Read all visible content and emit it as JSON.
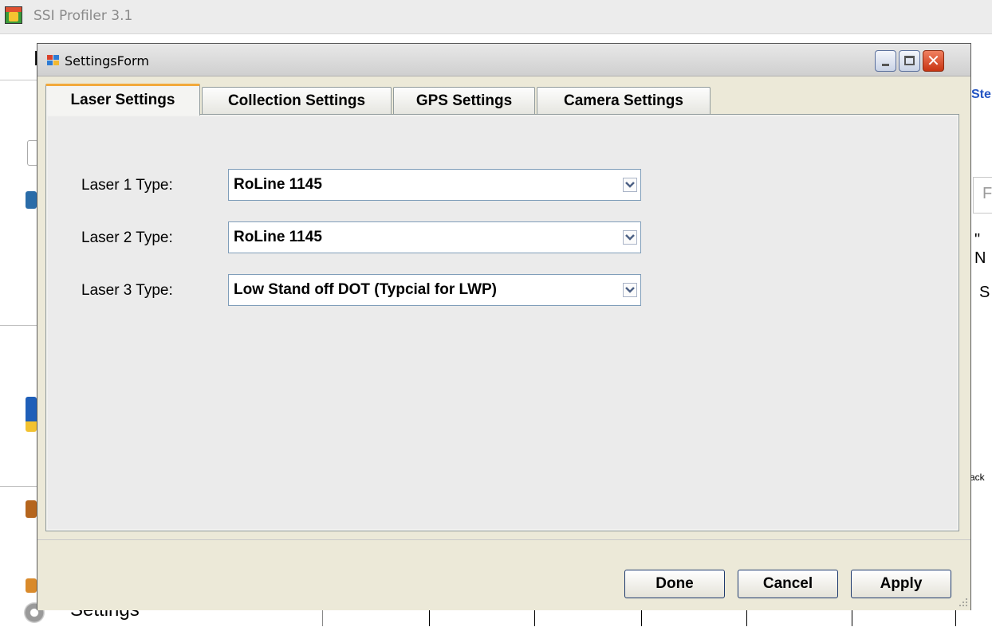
{
  "app": {
    "title": "SSI Profiler 3.1",
    "bg_letter": "F",
    "bg_settings_label": "Settings",
    "bg_right_ste": "Ste",
    "bg_right_p": "F",
    "bg_right_n": "\" N",
    "bg_right_s": "S",
    "bg_right_ack": "ack"
  },
  "dialog": {
    "title": "SettingsForm",
    "tabs": [
      {
        "label": "Laser Settings",
        "active": true
      },
      {
        "label": "Collection Settings",
        "active": false
      },
      {
        "label": "GPS Settings",
        "active": false
      },
      {
        "label": "Camera Settings",
        "active": false
      }
    ],
    "fields": [
      {
        "label": "Laser 1 Type:",
        "value": "RoLine 1145"
      },
      {
        "label": "Laser 2 Type:",
        "value": "RoLine 1145"
      },
      {
        "label": "Laser 3 Type:",
        "value": "Low Stand off DOT (Typcial for LWP)"
      }
    ],
    "buttons": {
      "done": "Done",
      "cancel": "Cancel",
      "apply": "Apply"
    }
  },
  "icons": {
    "app": "app-icon",
    "dialog": "form-icon",
    "minimize": "minimize-icon",
    "maximize": "maximize-icon",
    "close": "close-icon",
    "dropdown": "chevron-down-icon",
    "settings": "gear-icon"
  },
  "colors": {
    "tab_highlight": "#f2a93a",
    "close_button": "#c83412",
    "dialog_bg": "#ece9d8"
  }
}
